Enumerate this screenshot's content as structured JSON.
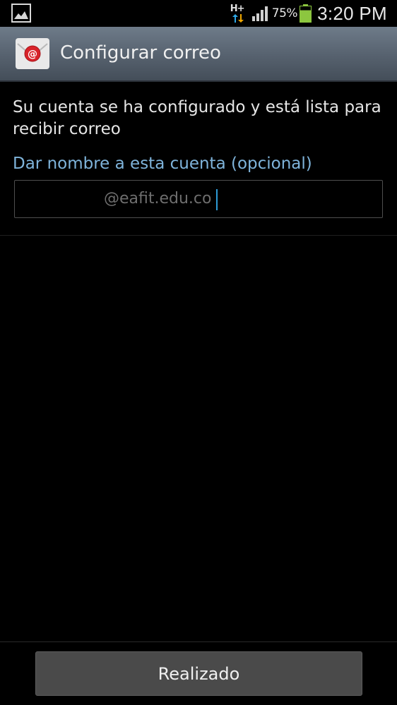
{
  "status_bar": {
    "notification_icon": "gallery-icon",
    "network_type": "H+",
    "battery_percent": "75%",
    "battery_level": 0.75,
    "time": "3:20 PM",
    "colors": {
      "network_up": "#2ea8e6",
      "network_down": "#f0a800",
      "battery": "#8cc63f"
    }
  },
  "action_bar": {
    "icon": "email-at-icon",
    "title": "Configurar correo"
  },
  "content": {
    "message": "Su cuenta se ha configurado y está lista para recibir correo",
    "account_name_label": "Dar nombre a esta cuenta (opcional)",
    "account_name_value": "@eafit.edu.co"
  },
  "footer": {
    "done_label": "Realizado"
  },
  "colors": {
    "label_accent": "#7fb4db",
    "caret": "#2d9bd6",
    "action_bar": "#56616e"
  }
}
